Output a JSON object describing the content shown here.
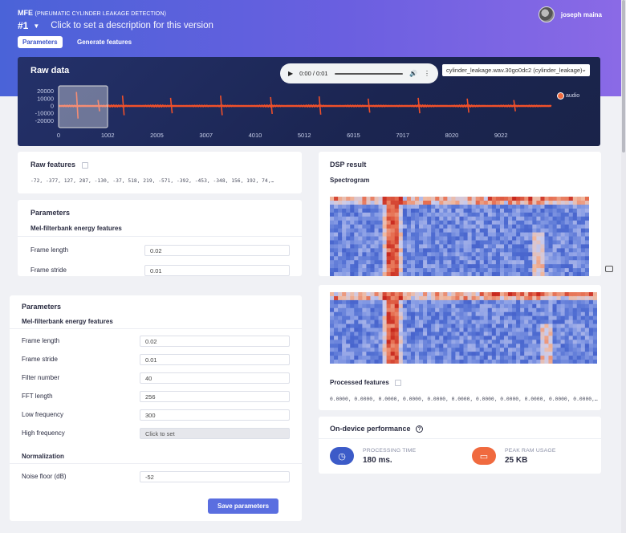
{
  "header": {
    "project_name": "MFE",
    "project_subtitle": "(PNEUMATIC CYLINDER LEAKAGE DETECTION)",
    "version": "#1",
    "version_description_placeholder": "Click to set a description for this version",
    "tabs": [
      {
        "label": "Parameters",
        "active": true
      },
      {
        "label": "Generate features",
        "active": false
      }
    ],
    "user_name": "joseph maina"
  },
  "raw_data": {
    "title": "Raw data",
    "audio_time": "0:00 / 0:01",
    "sample_select": "cylinder_leakage.wav.30go0dc2 (cylinder_leakage)",
    "legend_label": "audio",
    "chart_data": {
      "type": "line",
      "y_ticks": [
        "20000",
        "10000",
        "0",
        "-10000",
        "-20000"
      ],
      "x_ticks": [
        "0",
        "1002",
        "2005",
        "3007",
        "4010",
        "5012",
        "6015",
        "7017",
        "8020",
        "9022"
      ],
      "ylim": [
        -25000,
        25000
      ],
      "xlim": [
        0,
        10050
      ],
      "series_color": "#f0502a",
      "window_range": [
        0,
        1000
      ],
      "spikes": [
        {
          "x": 380,
          "amp": 19000
        },
        {
          "x": 820,
          "amp": 8000
        },
        {
          "x": 1320,
          "amp": 14000
        },
        {
          "x": 2300,
          "amp": 11000
        },
        {
          "x": 3320,
          "amp": 14000
        },
        {
          "x": 4340,
          "amp": 12000
        },
        {
          "x": 5330,
          "amp": 13000
        },
        {
          "x": 6330,
          "amp": 10000
        },
        {
          "x": 7350,
          "amp": 11000
        },
        {
          "x": 8350,
          "amp": 10000
        },
        {
          "x": 9300,
          "amp": 8000
        }
      ]
    }
  },
  "raw_features": {
    "title": "Raw features",
    "values": "-72, -377, 127, 287, -130, -37, 518, 219, -571, -392, -453, -348, 156, 192, 74,…"
  },
  "params_top": {
    "title": "Parameters",
    "subtitle": "Mel-filterbank energy features",
    "rows": [
      {
        "label": "Frame length",
        "value": "0.02"
      },
      {
        "label": "Frame stride",
        "value": "0.01"
      }
    ]
  },
  "params_main": {
    "title": "Parameters",
    "subtitle": "Mel-filterbank energy features",
    "rows": [
      {
        "label": "Frame length",
        "value": "0.02"
      },
      {
        "label": "Frame stride",
        "value": "0.01"
      },
      {
        "label": "Filter number",
        "value": "40"
      },
      {
        "label": "FFT length",
        "value": "256"
      },
      {
        "label": "Low frequency",
        "value": "300"
      },
      {
        "label": "High frequency",
        "value": "Click to set"
      }
    ],
    "normalization_title": "Normalization",
    "noise_floor_label": "Noise floor (dB)",
    "noise_floor_value": "-52",
    "save_label": "Save parameters"
  },
  "dsp": {
    "title": "DSP result",
    "spectrogram_label": "Spectrogram",
    "processed_title": "Processed features",
    "processed_values": "0.0000, 0.0000, 0.0000, 0.0000, 0.0000, 0.0000, 0.0000, 0.0000, 0.0000, 0.0000, 0.0000,…"
  },
  "performance": {
    "title": "On-device performance",
    "processing_label": "PROCESSING TIME",
    "processing_value": "180 ms.",
    "ram_label": "PEAK RAM USAGE",
    "ram_value": "25 KB"
  },
  "colors": {
    "accent": "#5a6ee0",
    "processing_icon": "#3c5bc8",
    "ram_icon": "#f06a3f"
  }
}
